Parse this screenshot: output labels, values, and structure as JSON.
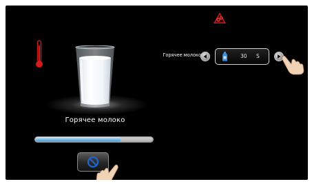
{
  "product": {
    "name": "Горячее молоко"
  },
  "progress": {
    "value": 0.73
  },
  "setting": {
    "label": "Горячее молоко",
    "quantity": "30",
    "unit": "S"
  },
  "icons": {
    "top_center": "maintenance-warning-icon",
    "temperature": "thermometer-icon",
    "drink": "glass-of-milk-icon",
    "cancel": "cancel-icon",
    "bottle": "milk-bottle-icon",
    "decrease": "arrow-left-icon",
    "increase": "arrow-right-icon",
    "pointer": "pointing-hand-icon"
  },
  "colors": {
    "background": "#000000",
    "accent_red": "#d11a1a",
    "progress_blue": "#6fb2dd",
    "bottle_blue": "#3a8fd8",
    "cancel_blue": "#1e64c8"
  }
}
